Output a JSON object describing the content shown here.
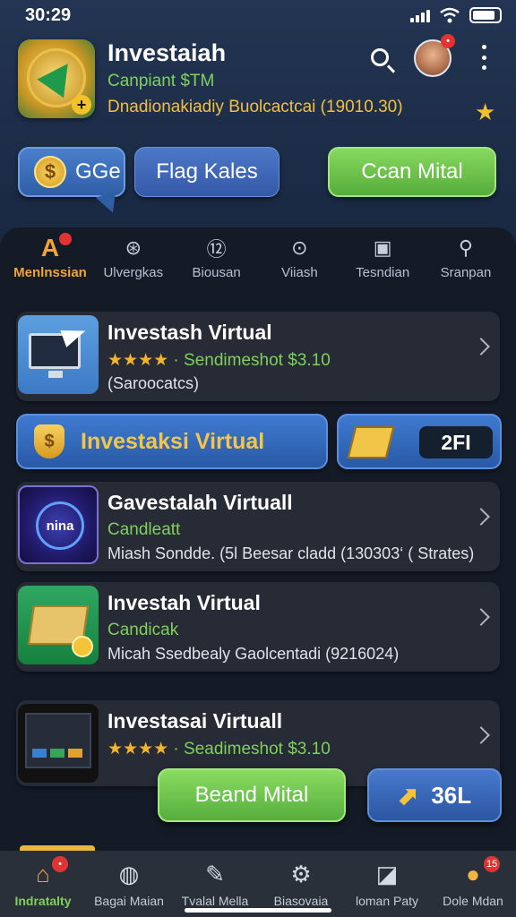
{
  "status": {
    "time": "30:29"
  },
  "header": {
    "title": "Investaiah",
    "subtitle": "Canpiant $TM",
    "line": "Dnadionakiadiy Buolcactcai (19010.30)"
  },
  "actions": {
    "ge_label": "GGe",
    "ge_icon": "$",
    "flag_label": "Flag Kales",
    "scan_label": "Ccan Mital"
  },
  "tabs": [
    {
      "label": "Menlnssian",
      "icon": "A"
    },
    {
      "label": "Ulvergkas",
      "icon": "⊛"
    },
    {
      "label": "Biousan",
      "icon": "⑫"
    },
    {
      "label": "Viiash",
      "icon": "⊙"
    },
    {
      "label": "Tesndian",
      "icon": "▣"
    },
    {
      "label": "Sranpan",
      "icon": "⚲"
    }
  ],
  "cards": [
    {
      "title": "Investash Virtual",
      "stars": "★★★★",
      "rating_text": " · Sendimeshot",
      "price": "$3.10",
      "line3": "(Saroocatcs)"
    },
    {
      "title": "Gavestalah Virtuall",
      "line2": "Candleatt",
      "line3": "Miash Sondde. (5l Beesar cladd (130303‘ ( Strates)",
      "thumb_text": "nina"
    },
    {
      "title": "Investah Virtual",
      "line2": "Candicak",
      "line3": "Micah Ssedbealy  Gaolcentadi  (9216024)"
    },
    {
      "title": "Investasai Virtuall",
      "stars": "★★★★",
      "rating_text": " · Seadimeshot",
      "price": "$3.10"
    }
  ],
  "wide_button": {
    "label": "Investaksi Virtual",
    "icon": "$"
  },
  "count_chip": "2FI",
  "float_buttons": {
    "green": "Beand Mital",
    "blue": "36L"
  },
  "nav": [
    {
      "label": "Indratalty",
      "badge": ""
    },
    {
      "label": "Bagai Maian",
      "badge": ""
    },
    {
      "label": "Tvalal Mella",
      "badge": ""
    },
    {
      "label": "Biasovaia",
      "badge": ""
    },
    {
      "label": "loman Paty",
      "badge": ""
    },
    {
      "label": "Dole Mdan",
      "badge": "15"
    }
  ],
  "colors": {
    "accent_green": "#7fd15c",
    "accent_orange": "#f2a33a",
    "badge_red": "#e03434",
    "button_blue": "#3459a8"
  }
}
